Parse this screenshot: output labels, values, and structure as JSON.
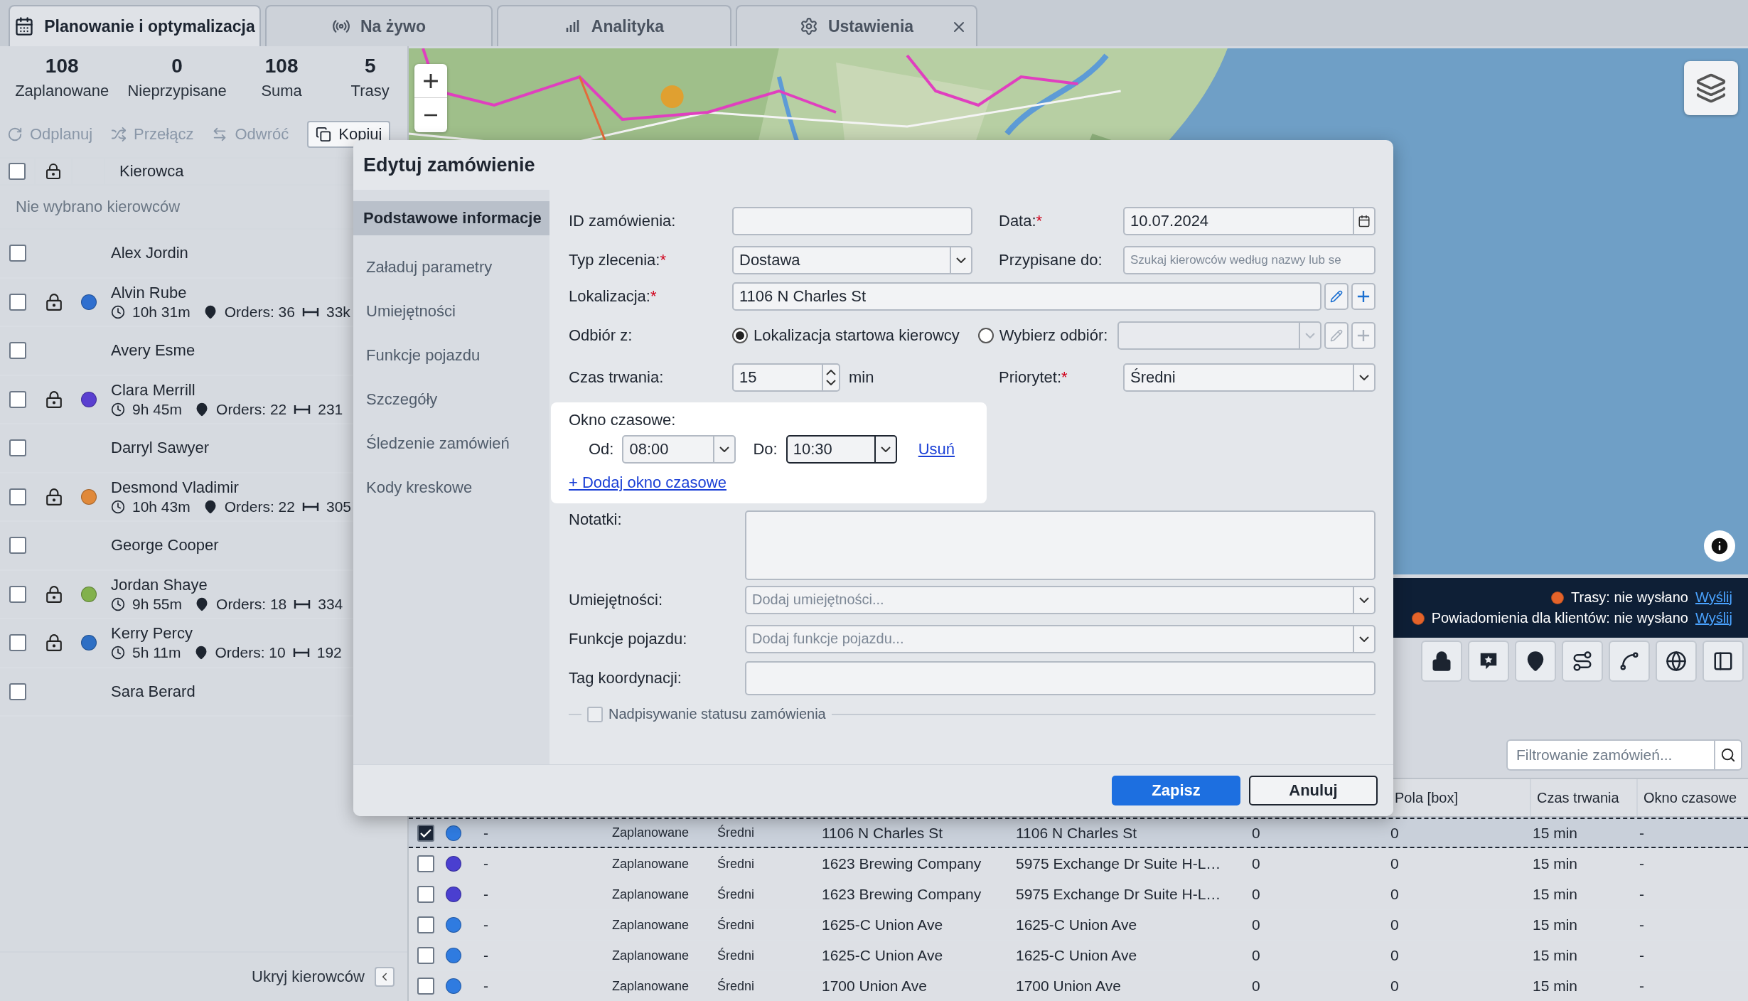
{
  "tabs": [
    {
      "label": "Planowanie i optymalizacja",
      "selected": true,
      "closable": false
    },
    {
      "label": "Na żywo",
      "selected": false,
      "closable": false
    },
    {
      "label": "Analityka",
      "selected": false,
      "closable": false
    },
    {
      "label": "Ustawienia",
      "selected": false,
      "closable": true
    }
  ],
  "summary": [
    {
      "value": "108",
      "label": "Zaplanowane"
    },
    {
      "value": "0",
      "label": "Nieprzypisane"
    },
    {
      "value": "108",
      "label": "Suma"
    },
    {
      "value": "5",
      "label": "Trasy"
    }
  ],
  "actions": [
    {
      "label": "Odplanuj",
      "disabled": true
    },
    {
      "label": "Przełącz",
      "disabled": true
    },
    {
      "label": "Odwróć",
      "disabled": true
    },
    {
      "label": "Kopiuj",
      "disabled": false
    }
  ],
  "drivers_table": {
    "header": "Kierowca",
    "all_checked": false,
    "empty_note": "Nie wybrano kierowców",
    "drivers": [
      {
        "name": "Alex Jordin",
        "checked": false,
        "locked": false
      },
      {
        "name": "Alvin Rube",
        "checked": false,
        "locked": true,
        "color": "#2f6fcf",
        "time": "10h 31m",
        "orders": "Orders: 36",
        "distance": "33k"
      },
      {
        "name": "Avery Esme",
        "checked": false,
        "locked": false
      },
      {
        "name": "Clara Merrill",
        "checked": false,
        "locked": true,
        "color": "#5a3fd0",
        "time": "9h 45m",
        "orders": "Orders: 22",
        "distance": "231"
      },
      {
        "name": "Darryl Sawyer",
        "checked": false,
        "locked": false
      },
      {
        "name": "Desmond Vladimir",
        "checked": false,
        "locked": true,
        "color": "#e0893a",
        "time": "10h 43m",
        "orders": "Orders: 22",
        "distance": "305"
      },
      {
        "name": "George Cooper",
        "checked": false,
        "locked": false
      },
      {
        "name": "Jordan Shaye",
        "checked": false,
        "locked": true,
        "color": "#82b14c",
        "time": "9h 55m",
        "orders": "Orders: 18",
        "distance": "334"
      },
      {
        "name": "Kerry Percy",
        "checked": false,
        "locked": true,
        "color": "#2e6fc4",
        "time": "5h 11m",
        "orders": "Orders: 10",
        "distance": "192"
      },
      {
        "name": "Sara Berard",
        "checked": false,
        "locked": false
      }
    ]
  },
  "hide_drivers": {
    "label": "Ukryj kierowców"
  },
  "notifications": [
    {
      "text": "Trasy: nie wysłano",
      "link": "Wyślij"
    },
    {
      "text": "Powiadomienia dla klientów: nie wysłano",
      "link": "Wyślij"
    }
  ],
  "order_filter": {
    "placeholder": "Filtrowanie zamówień..."
  },
  "orders_table": {
    "columns": [
      "",
      "",
      "",
      "",
      "",
      "",
      "Pola [box]",
      "Czas trwania",
      "Okno czasowe"
    ],
    "rows": [
      {
        "selected": true,
        "checked": true,
        "color": "#2f7be0",
        "cells": [
          "-",
          "Zaplanowane",
          "Średni",
          "1106 N Charles St",
          "1106 N Charles St",
          "0",
          "0",
          "15 min",
          "-"
        ]
      },
      {
        "selected": false,
        "checked": false,
        "color": "#4a3fd0",
        "cells": [
          "-",
          "Zaplanowane",
          "Średni",
          "1623 Brewing Company",
          "5975 Exchange Dr Suite H-L…",
          "0",
          "0",
          "15 min",
          "-"
        ]
      },
      {
        "selected": false,
        "checked": false,
        "color": "#4a3fd0",
        "cells": [
          "-",
          "Zaplanowane",
          "Średni",
          "1623 Brewing Company",
          "5975 Exchange Dr Suite H-L…",
          "0",
          "0",
          "15 min",
          "-"
        ]
      },
      {
        "selected": false,
        "checked": false,
        "color": "#2f7be0",
        "cells": [
          "-",
          "Zaplanowane",
          "Średni",
          "1625-C Union Ave",
          "1625-C Union Ave",
          "0",
          "0",
          "15 min",
          "-"
        ]
      },
      {
        "selected": false,
        "checked": false,
        "color": "#2f7be0",
        "cells": [
          "-",
          "Zaplanowane",
          "Średni",
          "1625-C Union Ave",
          "1625-C Union Ave",
          "0",
          "0",
          "15 min",
          "-"
        ]
      },
      {
        "selected": false,
        "checked": false,
        "color": "#2f7be0",
        "cells": [
          "-",
          "Zaplanowane",
          "Średni",
          "1700 Union Ave",
          "1700 Union Ave",
          "0",
          "0",
          "15 min",
          "-"
        ]
      }
    ]
  },
  "dialog": {
    "title": "Edytuj zamówienie",
    "nav": [
      {
        "label": "Podstawowe informacje",
        "selected": true
      },
      {
        "label": "Załaduj parametry",
        "selected": false
      },
      {
        "label": "Umiejętności",
        "selected": false
      },
      {
        "label": "Funkcje pojazdu",
        "selected": false
      },
      {
        "label": "Szczegóły",
        "selected": false
      },
      {
        "label": "Śledzenie zamówień",
        "selected": false
      },
      {
        "label": "Kody kreskowe",
        "selected": false
      }
    ],
    "form_rows": [
      [
        {
          "kind": "text",
          "label": "ID zamówienia:"
        },
        {
          "kind": "date",
          "label": "Data:",
          "required_mark": "*",
          "value": "10.07.2024"
        }
      ],
      [
        {
          "kind": "select",
          "label": "Typ zlecenia:",
          "required_mark": "*",
          "value": "Dostawa"
        },
        {
          "kind": "text",
          "label": "Przypisane do:",
          "placeholder": "Szukaj kierowców według nazwy lub se"
        }
      ],
      [
        {
          "kind": "location",
          "label": "Lokalizacja:",
          "required_mark": "*",
          "value": "1106 N Charles St"
        }
      ],
      [
        {
          "kind": "pickup",
          "label": "Odbiór z:",
          "options": [
            {
              "label": "Lokalizacja startowa kierowcy",
              "selected": true
            },
            {
              "label": "Wybierz odbiór:",
              "selected": false
            }
          ]
        }
      ],
      [
        {
          "kind": "number",
          "label": "Czas trwania:",
          "value": "15",
          "unit": "min"
        },
        {
          "kind": "select",
          "label": "Priorytet:",
          "required_mark": "*",
          "value": "Średni"
        }
      ]
    ],
    "time_window": {
      "highlighted": true,
      "label": "Okno czasowe:",
      "from_label": "Od:",
      "from": "08:00",
      "to_label": "Do:",
      "to": "10:30",
      "remove": "Usuń",
      "add": "+ Dodaj okno czasowe"
    },
    "lower_fields": [
      {
        "kind": "textarea",
        "label": "Notatki:"
      },
      {
        "kind": "select",
        "label": "Umiejętności:",
        "placeholder": "Dodaj umiejętności..."
      },
      {
        "kind": "select",
        "label": "Funkcje pojazdu:",
        "placeholder": "Dodaj funkcje pojazdu..."
      },
      {
        "kind": "text",
        "label": "Tag koordynacji:"
      }
    ],
    "status_override": {
      "label": "Nadpisywanie statusu zamówienia",
      "checked": false
    },
    "buttons": [
      {
        "label": "Zapisz",
        "primary": true
      },
      {
        "label": "Anuluj",
        "primary": false
      }
    ]
  }
}
